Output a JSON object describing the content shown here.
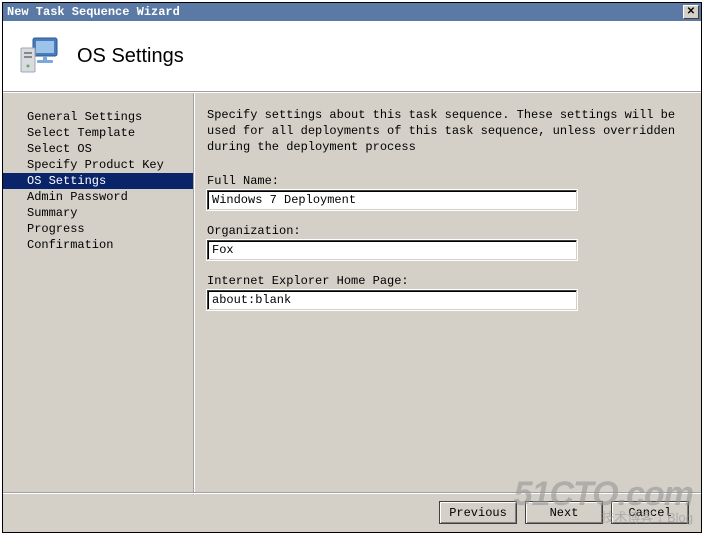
{
  "window": {
    "title": "New Task Sequence Wizard"
  },
  "header": {
    "title": "OS Settings"
  },
  "sidebar": {
    "items": [
      {
        "label": "General Settings",
        "selected": false
      },
      {
        "label": "Select Template",
        "selected": false
      },
      {
        "label": "Select OS",
        "selected": false
      },
      {
        "label": "Specify Product Key",
        "selected": false
      },
      {
        "label": "OS Settings",
        "selected": true
      },
      {
        "label": "Admin Password",
        "selected": false
      },
      {
        "label": "Summary",
        "selected": false
      },
      {
        "label": "Progress",
        "selected": false
      },
      {
        "label": "Confirmation",
        "selected": false
      }
    ]
  },
  "content": {
    "description": "Specify settings about this task sequence.  These settings will be used for all deployments of this task sequence, unless overridden during the deployment process",
    "full_name_label": "Full Name:",
    "full_name_value": "Windows 7 Deployment",
    "organization_label": "Organization:",
    "organization_value": "Fox",
    "ie_home_label": "Internet Explorer Home Page:",
    "ie_home_value": "about:blank"
  },
  "footer": {
    "previous": "Previous",
    "next": "Next",
    "cancel": "Cancel"
  },
  "watermark": {
    "line1": "51CTO.com",
    "line2": "技术博客 ↓ Blog"
  }
}
